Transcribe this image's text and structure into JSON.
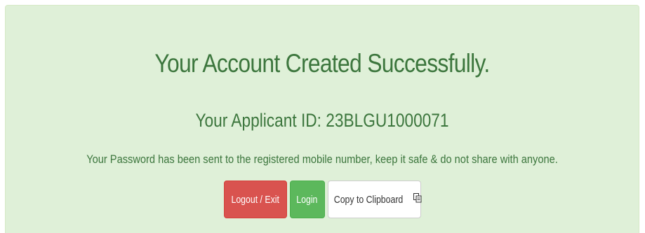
{
  "alert": {
    "title": "Your Account Created Successfully.",
    "applicant_label": "Your Applicant ID: 23BLGU1000071",
    "message": "Your Password has been sent to the registered mobile number, keep it safe & do not share with anyone."
  },
  "actions": {
    "logout_label": "Logout / Exit",
    "login_label": "Login",
    "copy_label": "Copy to Clipboard"
  },
  "icons": {
    "copy": "clipboard-icon"
  },
  "colors": {
    "alert_bg": "#dff0d8",
    "alert_text": "#3c763d",
    "danger": "#d9534f",
    "success": "#5cb85c",
    "default": "#ffffff"
  }
}
